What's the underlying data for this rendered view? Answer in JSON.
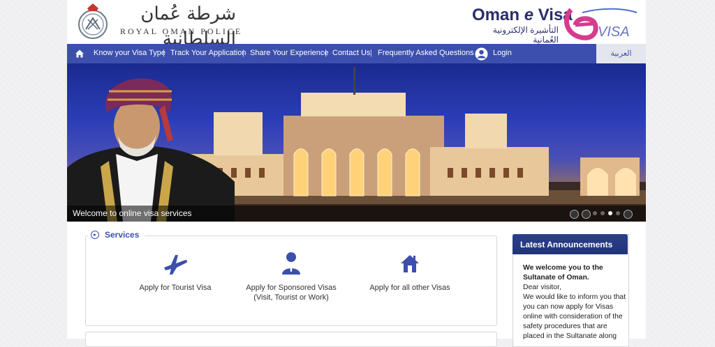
{
  "header": {
    "rop_arabic": "شرطة عُمان السلطانية",
    "rop_english": "ROYAL OMAN POLICE",
    "evisa_title_prefix": "Oman ",
    "evisa_title_e": "e",
    "evisa_title_suffix": " Visa",
    "evisa_arabic": "التأشيرة الإلكترونية العُمانية",
    "evisa_logo_text": "VISA"
  },
  "nav": {
    "items": [
      {
        "label": "Know your Visa Type"
      },
      {
        "label": "Track Your Application"
      },
      {
        "label": "Share Your Experience"
      },
      {
        "label": "Contact Us"
      },
      {
        "label": "Frequently Asked Questions"
      }
    ],
    "separator": "|",
    "login": "Login",
    "arabic": "العربية"
  },
  "banner": {
    "caption": "Welcome to online visa services",
    "slides": 4,
    "active_slide": 3
  },
  "services": {
    "title": "Services",
    "items": [
      {
        "icon": "airplane-icon",
        "line1": "Apply for Tourist Visa",
        "line2": ""
      },
      {
        "icon": "person-icon",
        "line1": "Apply for Sponsored Visas",
        "line2": "(Visit, Tourist or Work)"
      },
      {
        "icon": "house-icon",
        "line1": "Apply for all other Visas",
        "line2": ""
      }
    ]
  },
  "announcements": {
    "title": "Latest Announcements",
    "heading": "We welcome you to the Sultanate of Oman.",
    "greeting": "Dear visitor,",
    "body": "We would like to inform you that you can now apply for Visas online with consideration of the safety procedures that are placed in the Sultanate along"
  },
  "colors": {
    "nav_bg": "#3c4fae",
    "announcement_header": "#223477",
    "accent_text": "#3c4fae"
  }
}
